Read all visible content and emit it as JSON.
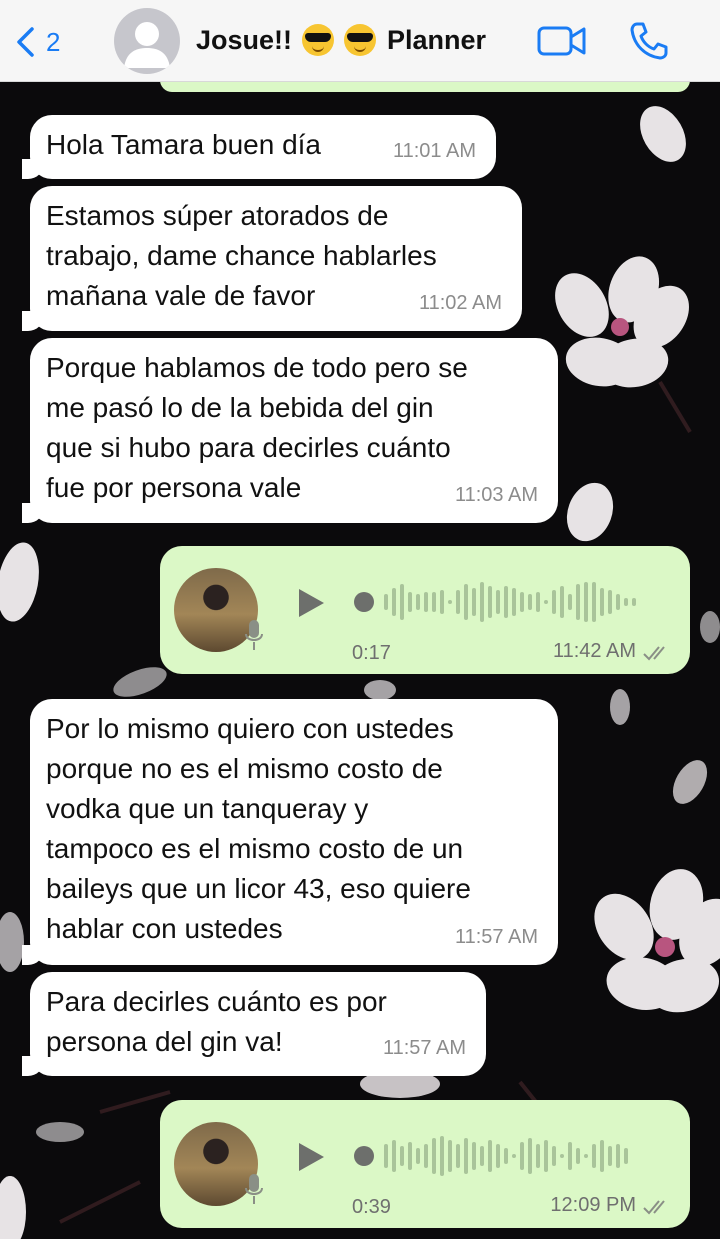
{
  "header": {
    "back_count": "2",
    "contact_name": "Josue!!",
    "contact_suffix": "Planner",
    "emoji_icons": [
      "smiling-face-with-sunglasses-icon",
      "smiling-face-with-sunglasses-icon"
    ]
  },
  "colors": {
    "accent": "#1a7cf4",
    "incoming_bubble": "#ffffff",
    "outgoing_bubble": "#dbf8c6",
    "chat_background": "#0b0a0c"
  },
  "messages": [
    {
      "type": "text",
      "direction": "incoming",
      "text": "Hola Tamara buen día",
      "time": "11:01 AM"
    },
    {
      "type": "text",
      "direction": "incoming",
      "text": "Estamos súper atorados de\ntrabajo, dame chance hablarles\nmañana vale de favor",
      "time": "11:02 AM"
    },
    {
      "type": "text",
      "direction": "incoming",
      "text": "Porque hablamos de todo pero se\nme pasó lo de la bebida del gin\nque si hubo para decirles cuánto\nfue por persona vale",
      "time": "11:03 AM"
    },
    {
      "type": "voice",
      "direction": "outgoing",
      "duration": "0:17",
      "time": "11:42 AM",
      "status": "read"
    },
    {
      "type": "text",
      "direction": "incoming",
      "text": "Por lo mismo quiero con ustedes\nporque no es el mismo costo de\nvodka que un tanqueray y\ntampoco es el mismo costo de un\nbaileys que un licor 43, eso quiere\nhablar con ustedes",
      "time": "11:57 AM"
    },
    {
      "type": "text",
      "direction": "incoming",
      "text": "Para decirles cuánto es por\npersona del gin va!",
      "time": "11:57 AM"
    },
    {
      "type": "voice",
      "direction": "outgoing",
      "duration": "0:39",
      "time": "12:09 PM",
      "status": "read"
    }
  ]
}
